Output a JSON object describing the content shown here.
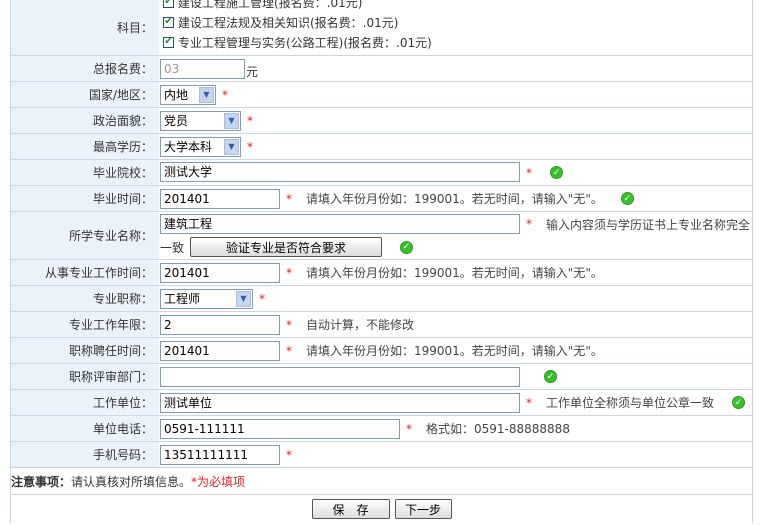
{
  "subjects": {
    "label": "科目：",
    "items": [
      "建设工程施工管理(报名费：.01元)",
      "建设工程法规及相关知识(报名费：.01元)",
      "专业工程管理与实务(公路工程)(报名费：.01元)"
    ]
  },
  "total_fee": {
    "label": "总报名费：",
    "value": "03",
    "unit": "元"
  },
  "country": {
    "label": "国家/地区：",
    "value": "内地",
    "required": "*"
  },
  "political": {
    "label": "政治面貌：",
    "value": "党员",
    "required": "*"
  },
  "education": {
    "label": "最高学历：",
    "value": "大学本科",
    "required": "*"
  },
  "school": {
    "label": "毕业院校：",
    "value": "测试大学",
    "required": "*"
  },
  "grad_time": {
    "label": "毕业时间：",
    "value": "201401",
    "required": "*",
    "hint": "请填入年份月份如：199001。若无时间，请输入\"无\"。"
  },
  "major": {
    "label": "所学专业名称：",
    "value": "建筑工程",
    "required": "*",
    "hint": "输入内容须与学历证书上专业名称完全",
    "hint2": "一致",
    "verify_button": "验证专业是否符合要求"
  },
  "work_time": {
    "label": "从事专业工作时间：",
    "value": "201401",
    "required": "*",
    "hint": "请填入年份月份如：199001。若无时间，请输入\"无\"。"
  },
  "title": {
    "label": "专业职称：",
    "value": "工程师",
    "required": "*"
  },
  "work_years": {
    "label": "专业工作年限：",
    "value": "2",
    "required": "*",
    "hint": "自动计算，不能修改"
  },
  "title_time": {
    "label": "职称聘任时间：",
    "value": "201401",
    "required": "*",
    "hint": "请填入年份月份如：199001。若无时间，请输入\"无\"。"
  },
  "review_dept": {
    "label": "职称评审部门：",
    "value": ""
  },
  "employer": {
    "label": "工作单位：",
    "value": "测试单位",
    "required": "*",
    "hint": "工作单位全称须与单位公章一致"
  },
  "work_phone": {
    "label": "单位电话：",
    "value": "0591-111111",
    "required": "*",
    "hint": "格式如：0591-88888888"
  },
  "mobile": {
    "label": "手机号码：",
    "value": "13511111111",
    "required": "*"
  },
  "notice": {
    "label": "注意事项：",
    "text": "请认真核对所填信息。",
    "required_note": "*为必填项"
  },
  "buttons": {
    "save": "保　存",
    "next": "下一步"
  },
  "icons": {
    "check": "✔",
    "ok": "✓",
    "arrow": "▼"
  },
  "colors": {
    "label_bg": "#eaf2fb",
    "border": "#c9d6e3",
    "required": "#e02020",
    "ok_green": "#3cbf2f"
  }
}
